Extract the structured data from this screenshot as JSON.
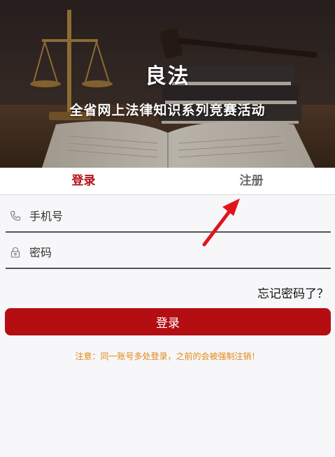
{
  "banner": {
    "title": "良法",
    "subtitle": "全省网上法律知识系列竞赛活动"
  },
  "tabs": [
    {
      "label": "登录",
      "active": true
    },
    {
      "label": "注册",
      "active": false
    }
  ],
  "form": {
    "phone": {
      "placeholder": "手机号",
      "value": "",
      "icon": "phone-icon"
    },
    "password": {
      "placeholder": "密码",
      "value": "",
      "icon": "lock-icon"
    },
    "forgot_label": "忘记密码了？",
    "login_label": "登录"
  },
  "notice": "注意：同一账号多处登录，之前的会被强制注销！",
  "colors": {
    "brand_red": "#b40d12",
    "notice_orange": "#e08a17",
    "annotation_arrow": "#e0141b"
  }
}
